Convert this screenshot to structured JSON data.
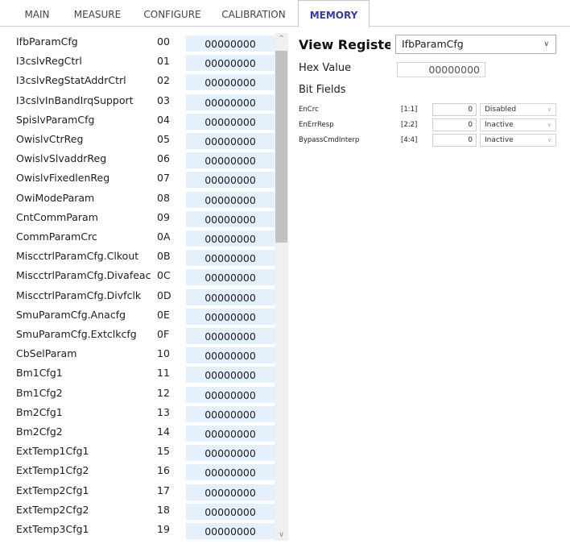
{
  "tabs": [
    {
      "label": "MAIN"
    },
    {
      "label": "MEASURE"
    },
    {
      "label": "CONFIGURE"
    },
    {
      "label": "CALIBRATION"
    },
    {
      "label": "MEMORY",
      "active": true
    }
  ],
  "registers": [
    {
      "name": "IfbParamCfg",
      "addr": "00",
      "value": "00000000"
    },
    {
      "name": "I3cslvRegCtrl",
      "addr": "01",
      "value": "00000000"
    },
    {
      "name": "I3cslvRegStatAddrCtrl",
      "addr": "02",
      "value": "00000000"
    },
    {
      "name": "I3cslvInBandIrqSupport",
      "addr": "03",
      "value": "00000000"
    },
    {
      "name": "SpislvParamCfg",
      "addr": "04",
      "value": "00000000"
    },
    {
      "name": "OwislvCtrReg",
      "addr": "05",
      "value": "00000000"
    },
    {
      "name": "OwislvSlvaddrReg",
      "addr": "06",
      "value": "00000000"
    },
    {
      "name": "OwislvFixedlenReg",
      "addr": "07",
      "value": "00000000"
    },
    {
      "name": "OwiModeParam",
      "addr": "08",
      "value": "00000000"
    },
    {
      "name": "CntCommParam",
      "addr": "09",
      "value": "00000000"
    },
    {
      "name": "CommParamCrc",
      "addr": "0A",
      "value": "00000000"
    },
    {
      "name": "MiscctrlParamCfg.Clkout",
      "addr": "0B",
      "value": "00000000"
    },
    {
      "name": "MiscctrlParamCfg.Divafeac",
      "addr": "0C",
      "value": "00000000"
    },
    {
      "name": "MiscctrlParamCfg.Divfclk",
      "addr": "0D",
      "value": "00000000"
    },
    {
      "name": "SmuParamCfg.Anacfg",
      "addr": "0E",
      "value": "00000000"
    },
    {
      "name": "SmuParamCfg.Extclkcfg",
      "addr": "0F",
      "value": "00000000"
    },
    {
      "name": "CbSelParam",
      "addr": "10",
      "value": "00000000"
    },
    {
      "name": "Bm1Cfg1",
      "addr": "11",
      "value": "00000000"
    },
    {
      "name": "Bm1Cfg2",
      "addr": "12",
      "value": "00000000"
    },
    {
      "name": "Bm2Cfg1",
      "addr": "13",
      "value": "00000000"
    },
    {
      "name": "Bm2Cfg2",
      "addr": "14",
      "value": "00000000"
    },
    {
      "name": "ExtTemp1Cfg1",
      "addr": "15",
      "value": "00000000"
    },
    {
      "name": "ExtTemp1Cfg2",
      "addr": "16",
      "value": "00000000"
    },
    {
      "name": "ExtTemp2Cfg1",
      "addr": "17",
      "value": "00000000"
    },
    {
      "name": "ExtTemp2Cfg2",
      "addr": "18",
      "value": "00000000"
    },
    {
      "name": "ExtTemp3Cfg1",
      "addr": "19",
      "value": "00000000"
    }
  ],
  "scrollbar": {
    "up_icon": "chevron-up-icon",
    "down_icon": "chevron-down-icon"
  },
  "view_register": {
    "label": "View Register",
    "selected": "IfbParamCfg",
    "hex_label": "Hex Value",
    "hex_value": "00000000",
    "bit_fields_label": "Bit Fields",
    "bit_fields": [
      {
        "name": "EnCrc",
        "range": "[1:1]",
        "value": "0",
        "state": "Disabled"
      },
      {
        "name": "EnErrResp",
        "range": "[2:2]",
        "value": "0",
        "state": "Inactive"
      },
      {
        "name": "BypassCmdInterp",
        "range": "[4:4]",
        "value": "0",
        "state": "Inactive"
      }
    ]
  },
  "colors": {
    "active_tab": "#3b3b9c",
    "value_cell_bg": "#e4f0fb",
    "scroll_thumb": "#c2c2c2"
  }
}
